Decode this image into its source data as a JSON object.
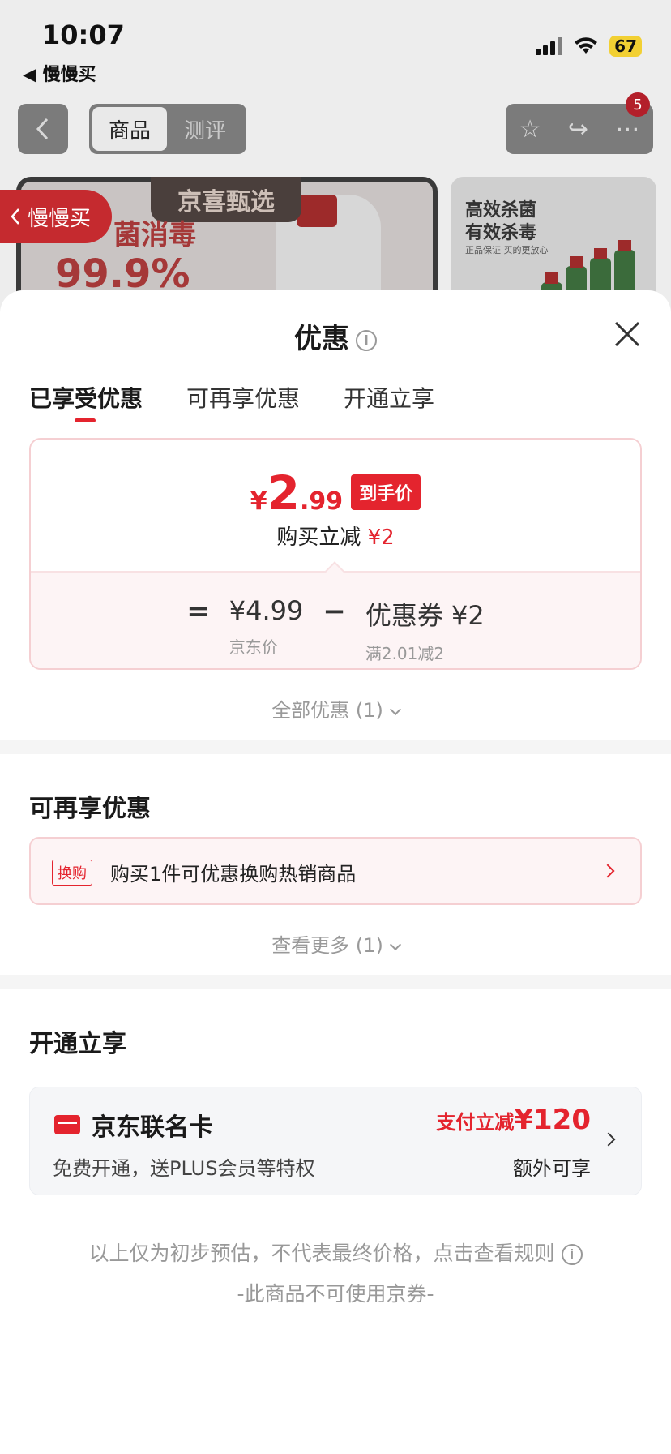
{
  "status": {
    "time": "10:07",
    "back_app": "◀ 慢慢买",
    "battery": "67"
  },
  "nav": {
    "tabs": [
      "商品",
      "测评"
    ],
    "badge": "5"
  },
  "banner": {
    "tag": "京喜甄选",
    "text_top": "菌消毒",
    "text_big": "99.9%",
    "right_title_1": "高效杀菌",
    "right_title_2": "有效杀毒",
    "right_sub": "正品保证 买的更放心"
  },
  "float_tag": "慢慢买",
  "sheet": {
    "title": "优惠",
    "tabs": [
      "已享受优惠",
      "可再享优惠",
      "开通立享"
    ],
    "price": {
      "currency": "¥",
      "int": "2",
      "dec": ".99",
      "pill": "到手价",
      "reduce_label": "购买立减 ",
      "reduce_value": "¥2",
      "eq": "=",
      "minus": "−",
      "base_price": "¥4.99",
      "base_label": "京东价",
      "coupon": "优惠券 ¥2",
      "coupon_rule": "满2.01减2"
    },
    "all_deals": "全部优惠 (1)",
    "section2_title": "可再享优惠",
    "swap": {
      "tag": "换购",
      "text": "购买1件可优惠换购热销商品"
    },
    "see_more": "查看更多 (1)",
    "section3_title": "开通立享",
    "card": {
      "name": "京东联名卡",
      "desc": "免费开通，送PLUS会员等特权",
      "promo_label": "支付立减",
      "promo_value": "¥120",
      "extra": "额外可享"
    },
    "footer_note": "以上仅为初步预估，不代表最终价格，点击查看规则",
    "footer_note2": "-此商品不可使用京券-"
  },
  "colors": {
    "accent": "#e4242e",
    "sheet_bg": "#ffffff",
    "muted": "#999999"
  }
}
